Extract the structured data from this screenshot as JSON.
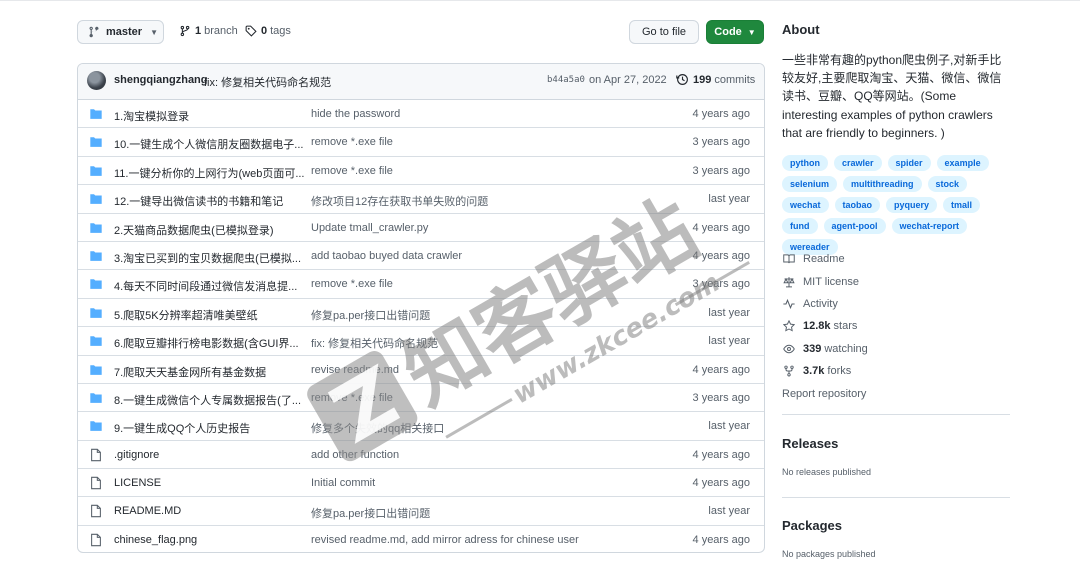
{
  "toolbar": {
    "branch": "master",
    "branch_count": "1",
    "branch_label": "branch",
    "tag_count": "0",
    "tag_label": "tags",
    "goto_file": "Go to file",
    "code": "Code"
  },
  "commit": {
    "author": "shengqiangzhang",
    "message": "fix: 修复相关代码命名规范",
    "sha": "b44a5a0",
    "date": "on Apr 27, 2022",
    "count": "199",
    "count_label": "commits"
  },
  "files": [
    {
      "type": "folder",
      "name": "1.淘宝模拟登录",
      "message": "hide the password",
      "date": "4 years ago"
    },
    {
      "type": "folder",
      "name": "10.一键生成个人微信朋友圈数据电子...",
      "message": "remove *.exe file",
      "date": "3 years ago"
    },
    {
      "type": "folder",
      "name": "11.一键分析你的上网行为(web页面可...",
      "message": "remove *.exe file",
      "date": "3 years ago"
    },
    {
      "type": "folder",
      "name": "12.一键导出微信读书的书籍和笔记",
      "message": "修改项目12存在获取书单失败的问题",
      "date": "last year"
    },
    {
      "type": "folder",
      "name": "2.天猫商品数据爬虫(已模拟登录)",
      "message": "Update tmall_crawler.py",
      "date": "4 years ago"
    },
    {
      "type": "folder",
      "name": "3.淘宝已买到的宝贝数据爬虫(已模拟...",
      "message": "add taobao buyed data crawler",
      "date": "4 years ago"
    },
    {
      "type": "folder",
      "name": "4.每天不同时间段通过微信发消息提...",
      "message": "remove *.exe file",
      "date": "3 years ago"
    },
    {
      "type": "folder",
      "name": "5.爬取5K分辨率超清唯美壁纸",
      "message": "修复pa.per接口出错问题",
      "date": "last year"
    },
    {
      "type": "folder",
      "name": "6.爬取豆瓣排行榜电影数据(含GUI界...",
      "message": "fix: 修复相关代码命名规范",
      "date": "last year"
    },
    {
      "type": "folder",
      "name": "7.爬取天天基金网所有基金数据",
      "message": "revise readme.md",
      "date": "4 years ago"
    },
    {
      "type": "folder",
      "name": "8.一键生成微信个人专属数据报告(了...",
      "message": "remove *.exe file",
      "date": "3 years ago"
    },
    {
      "type": "folder",
      "name": "9.一键生成QQ个人历史报告",
      "message": "修复多个失效的qq相关接口",
      "date": "last year"
    },
    {
      "type": "file",
      "name": ".gitignore",
      "message": "add other function",
      "date": "4 years ago"
    },
    {
      "type": "file",
      "name": "LICENSE",
      "message": "Initial commit",
      "date": "4 years ago"
    },
    {
      "type": "file",
      "name": "README.MD",
      "message": "修复pa.per接口出错问题",
      "date": "last year"
    },
    {
      "type": "file",
      "name": "chinese_flag.png",
      "message": "revised readme.md, add mirror adress for chinese user",
      "date": "4 years ago"
    }
  ],
  "about": {
    "title": "About",
    "description": "一些非常有趣的python爬虫例子,对新手比较友好,主要爬取淘宝、天猫、微信、微信读书、豆瓣、QQ等网站。(Some interesting examples of python crawlers that are friendly to beginners. )",
    "topics": [
      "python",
      "crawler",
      "spider",
      "example",
      "selenium",
      "multithreading",
      "stock",
      "wechat",
      "taobao",
      "pyquery",
      "tmall",
      "fund",
      "agent-pool",
      "wechat-report",
      "wereader"
    ],
    "readme": "Readme",
    "license": "MIT license",
    "activity": "Activity",
    "stars": "12.8k",
    "stars_label": "stars",
    "watching": "339",
    "watching_label": "watching",
    "forks": "3.7k",
    "forks_label": "forks",
    "report": "Report repository"
  },
  "releases": {
    "title": "Releases",
    "note": "No releases published"
  },
  "packages": {
    "title": "Packages",
    "note": "No packages published"
  },
  "watermark": {
    "brand": "知客驿站",
    "url": "www.zkcee.com"
  },
  "colors": {
    "accent": "#0969da",
    "folder": "#54aeff",
    "code_button": "#1f883d",
    "topic_bg": "#ddf4ff"
  }
}
